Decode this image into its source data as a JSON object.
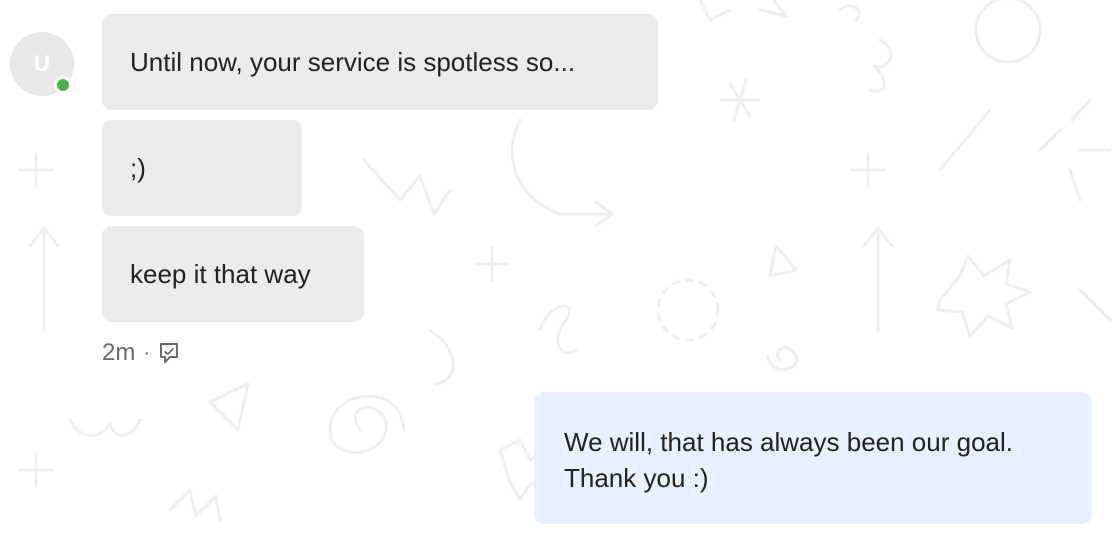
{
  "conversation": {
    "incoming": {
      "avatar_initial": "U",
      "messages": [
        {
          "text": "Until now, your service is spotless so..."
        },
        {
          "text": ";)"
        },
        {
          "text": "keep it that way"
        }
      ],
      "timestamp": "2m",
      "separator": "·",
      "seen_icon": "seen-icon"
    },
    "outgoing": {
      "messages": [
        {
          "text": "We will, that has always been our goal. Thank you :)"
        }
      ]
    }
  },
  "colors": {
    "incoming_bubble": "#ebebeb",
    "outgoing_bubble": "#e8f0fd",
    "presence_online": "#4caf50",
    "avatar_bg": "#e8e8e8"
  }
}
